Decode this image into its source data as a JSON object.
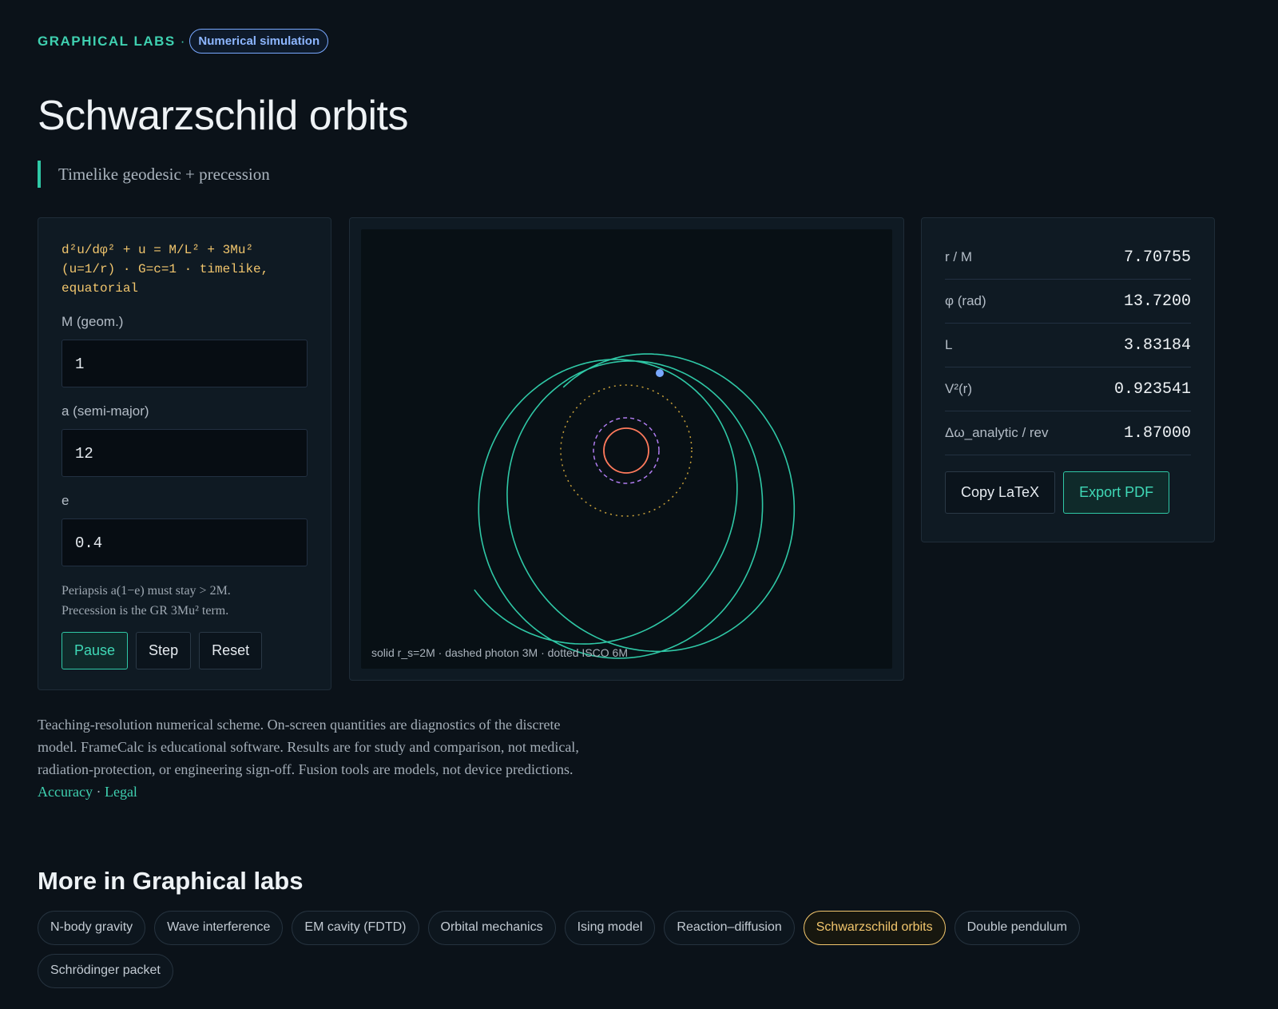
{
  "header": {
    "eyebrow": "GRAPHICAL LABS",
    "eyebrow_sep": "·",
    "badge": "Numerical simulation",
    "title": "Schwarzschild orbits",
    "subtitle": "Timelike geodesic + precession"
  },
  "controls": {
    "equation": "d²u/dφ² + u = M/L² + 3Mu² (u=1/r) · G=c=1 · timelike, equatorial",
    "fields": [
      {
        "label": "M (geom.)",
        "value": "1"
      },
      {
        "label": "a (semi-major)",
        "value": "12"
      },
      {
        "label": "e",
        "value": "0.4"
      }
    ],
    "hint_line1": "Periapsis a(1−e) must stay > 2M.",
    "hint_line2": "Precession is the GR 3Mu² term.",
    "buttons": {
      "pause": "Pause",
      "step": "Step",
      "reset": "Reset"
    }
  },
  "canvas": {
    "legend": "solid r_s=2M · dashed photon 3M · dotted ISCO 6M",
    "colors": {
      "orbit": "#2fc8a6",
      "horizon": "#ff7a5c",
      "photon": "#b07cf0",
      "isco": "#c9a13a",
      "particle": "#79a8ff",
      "background": "#081015"
    }
  },
  "stats": [
    {
      "label": "r / M",
      "value": "7.70755"
    },
    {
      "label": "φ (rad)",
      "value": "13.7200"
    },
    {
      "label": "L",
      "value": "3.83184"
    },
    {
      "label": "V²(r)",
      "value": "0.923541"
    },
    {
      "label": "Δω_analytic / rev",
      "value": "1.87000"
    }
  ],
  "stat_buttons": {
    "copy": "Copy LaTeX",
    "export": "Export PDF"
  },
  "footnote": {
    "text": "Teaching-resolution numerical scheme. On-screen quantities are diagnostics of the discrete model. FrameCalc is educational software. Results are for study and comparison, not medical, radiation-protection, or engineering sign-off. Fusion tools are models, not device predictions.",
    "link_accuracy": "Accuracy",
    "link_sep": "·",
    "link_legal": "Legal"
  },
  "more": {
    "title": "More in Graphical labs",
    "chips": [
      {
        "label": "N-body gravity"
      },
      {
        "label": "Wave interference"
      },
      {
        "label": "EM cavity (FDTD)"
      },
      {
        "label": "Orbital mechanics"
      },
      {
        "label": "Ising model"
      },
      {
        "label": "Reaction–diffusion"
      },
      {
        "label": "Schwarzschild orbits"
      },
      {
        "label": "Double pendulum"
      },
      {
        "label": "Schrödinger packet"
      }
    ]
  }
}
